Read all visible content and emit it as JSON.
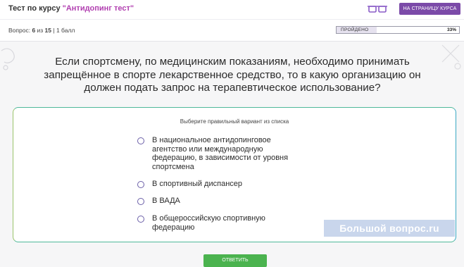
{
  "header": {
    "title_prefix": "Тест по курсу ",
    "course_name": "\"Антидопинг тест\"",
    "course_button": "НА СТРАНИЦУ КУРСА",
    "question_label": "Вопрос: ",
    "question_number": "6",
    "question_of": " из ",
    "question_total": "15",
    "points_separator": " | ",
    "points": "1 балл",
    "progress_label": "ПРОЙДЕНО",
    "progress_percent": "33%",
    "progress_value": 0.33
  },
  "question": {
    "text": "Если спортсмену, по медицинским показаниям, необходимо принимать запрещённое в спорте лекарственное средство, то в какую организацию он должен подать запрос на терапевтическое использование?"
  },
  "answers": {
    "instruction": "Выберите правильный вариант из списка",
    "options": [
      "В национальное антидопинговое агентство или международную федерацию, в зависимости от уровня спортсмена",
      "В спортивный диспансер",
      "В ВАДА",
      "В общероссийскую спортивную федерацию"
    ]
  },
  "submit_label": "ОТВЕТИТЬ",
  "watermark": "Большой вопрос.ru",
  "colors": {
    "accent_purple": "#7b4aa8",
    "course_name": "#b13fb0",
    "submit_green": "#4bb34f",
    "card_border": "#4fb89a"
  }
}
